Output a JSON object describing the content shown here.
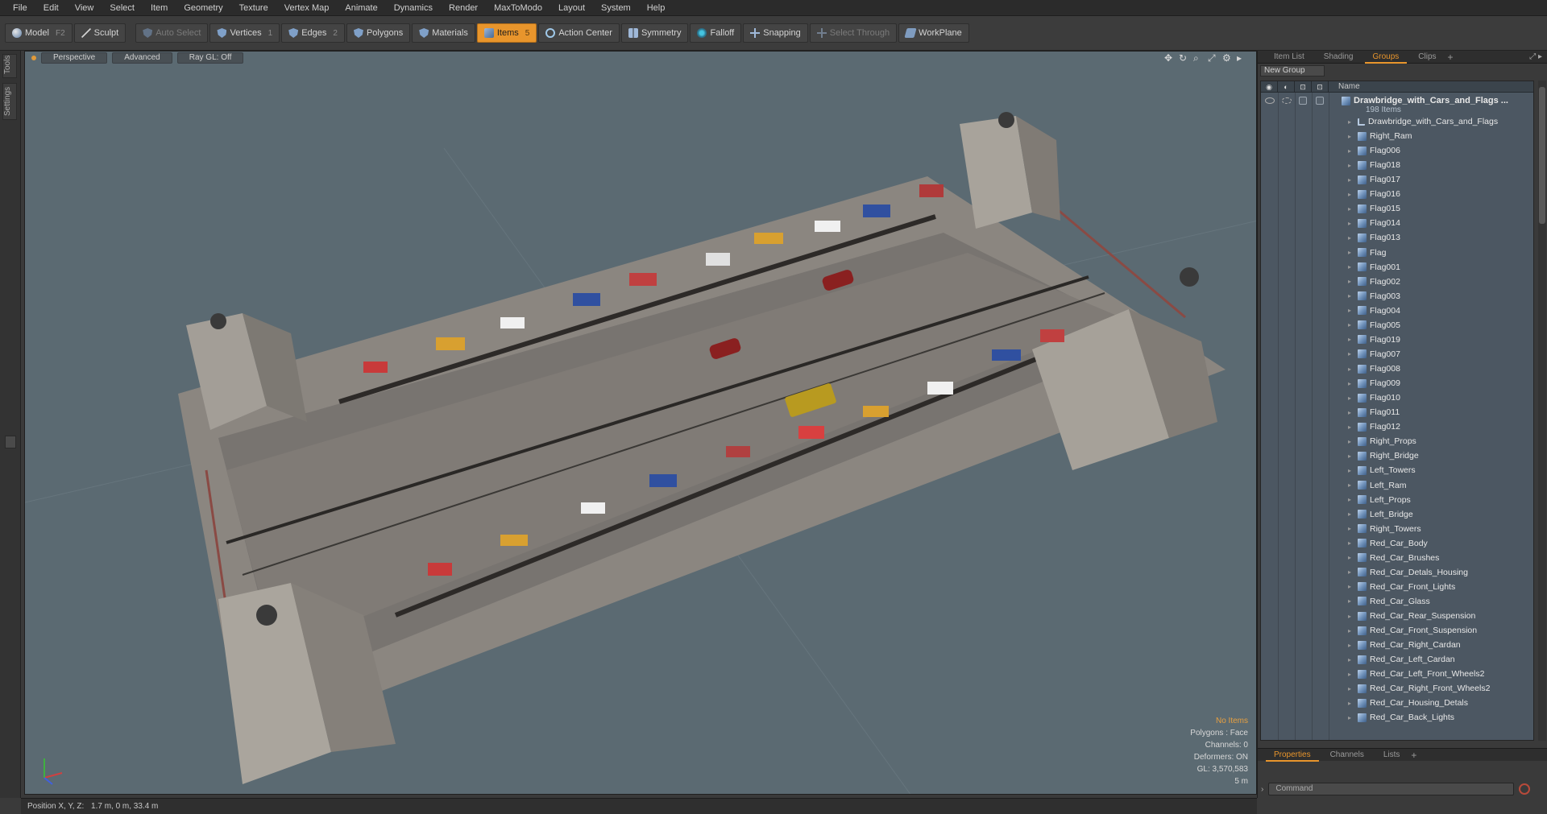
{
  "menu": [
    "File",
    "Edit",
    "View",
    "Select",
    "Item",
    "Geometry",
    "Texture",
    "Vertex Map",
    "Animate",
    "Dynamics",
    "Render",
    "MaxToModo",
    "Layout",
    "System",
    "Help"
  ],
  "toolbar": {
    "model": "Model",
    "model_key": "F2",
    "sculpt": "Sculpt",
    "auto_select": "Auto Select",
    "vertices": "Vertices",
    "vertices_key": "1",
    "edges": "Edges",
    "edges_key": "2",
    "polygons": "Polygons",
    "materials": "Materials",
    "items": "Items",
    "items_key": "5",
    "action_center": "Action Center",
    "symmetry": "Symmetry",
    "falloff": "Falloff",
    "snapping": "Snapping",
    "select_through": "Select Through",
    "workplane": "WorkPlane"
  },
  "left_tabs": [
    "Tools",
    "Settings"
  ],
  "viewport": {
    "view": "Perspective",
    "shading": "Advanced",
    "raygl": "Ray GL: Off",
    "stats": {
      "items": "No Items",
      "polygons": "Polygons : Face",
      "channels": "Channels: 0",
      "deformers": "Deformers: ON",
      "gl": "GL: 3,570,583",
      "scale": "5 m"
    }
  },
  "status": {
    "label": "Position X, Y, Z:",
    "value": "1.7 m, 0 m, 33.4 m"
  },
  "panel": {
    "tabs": [
      "Item List",
      "Shading",
      "Groups",
      "Clips"
    ],
    "active_tab": "Groups",
    "new_group": "New Group",
    "col_name": "Name",
    "group_name": "Drawbridge_with_Cars_and_Flags ...",
    "group_count": "198 Items",
    "items": [
      "Drawbridge_with_Cars_and_Flags",
      "Right_Ram",
      "Flag006",
      "Flag018",
      "Flag017",
      "Flag016",
      "Flag015",
      "Flag014",
      "Flag013",
      "Flag",
      "Flag001",
      "Flag002",
      "Flag003",
      "Flag004",
      "Flag005",
      "Flag019",
      "Flag007",
      "Flag008",
      "Flag009",
      "Flag010",
      "Flag011",
      "Flag012",
      "Right_Props",
      "Right_Bridge",
      "Left_Towers",
      "Left_Ram",
      "Left_Props",
      "Left_Bridge",
      "Right_Towers",
      "Red_Car_Body",
      "Red_Car_Brushes",
      "Red_Car_Detals_Housing",
      "Red_Car_Front_Lights",
      "Red_Car_Glass",
      "Red_Car_Rear_Suspension",
      "Red_Car_Front_Suspension",
      "Red_Car_Right_Cardan",
      "Red_Car_Left_Cardan",
      "Red_Car_Left_Front_Wheels2",
      "Red_Car_Right_Front_Wheels2",
      "Red_Car_Housing_Detals",
      "Red_Car_Back_Lights"
    ],
    "bottom_tabs": [
      "Properties",
      "Channels",
      "Lists"
    ],
    "bottom_active": "Properties",
    "command_placeholder": "Command"
  },
  "colors": {
    "accent": "#e8952c",
    "viewport_bg": "#5b6a72"
  }
}
